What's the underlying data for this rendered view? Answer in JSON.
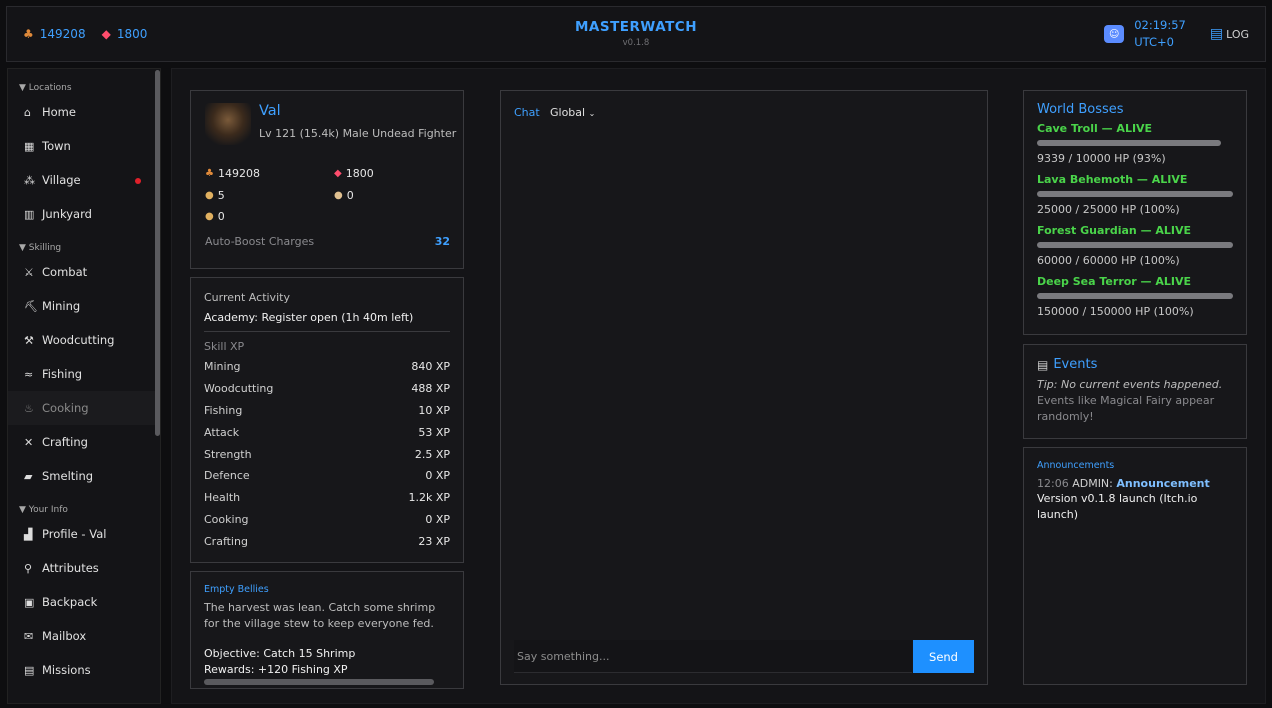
{
  "topbar": {
    "gold": "149208",
    "gems": "1800",
    "title": "MASTERWATCH",
    "version": "v0.1.8",
    "time": "02:19:57",
    "timezone": "UTC+0",
    "log_label": "LOG",
    "icons": {
      "gold": "coin-pile-icon",
      "gems": "gem-icon",
      "discord": "discord-icon",
      "log": "scroll-icon"
    }
  },
  "sidebar": {
    "sections": [
      {
        "label": "Locations",
        "items": [
          {
            "label": "Home",
            "icon": "house-icon"
          },
          {
            "label": "Town",
            "icon": "town-icon"
          },
          {
            "label": "Village",
            "icon": "village-icon",
            "notify": true
          },
          {
            "label": "Junkyard",
            "icon": "trash-icon"
          }
        ]
      },
      {
        "label": "Skilling",
        "items": [
          {
            "label": "Combat",
            "icon": "crossed-swords-icon"
          },
          {
            "label": "Mining",
            "icon": "pickaxe-icon"
          },
          {
            "label": "Woodcutting",
            "icon": "axe-icon"
          },
          {
            "label": "Fishing",
            "icon": "fish-icon"
          },
          {
            "label": "Cooking",
            "icon": "cooking-icon",
            "disabled": true
          },
          {
            "label": "Crafting",
            "icon": "hammer-icon"
          },
          {
            "label": "Smelting",
            "icon": "ingot-icon"
          }
        ]
      },
      {
        "label": "Your Info",
        "items": [
          {
            "label": "Profile - Val",
            "icon": "chart-icon"
          },
          {
            "label": "Attributes",
            "icon": "magnifier-icon"
          },
          {
            "label": "Backpack",
            "icon": "backpack-icon"
          },
          {
            "label": "Mailbox",
            "icon": "mail-icon"
          },
          {
            "label": "Missions",
            "icon": "missions-icon"
          }
        ]
      }
    ]
  },
  "character": {
    "name": "Val",
    "subtitle": "Lv 121 (15.4k)  Male Undead Fighter",
    "gold": "149208",
    "gems": "1800",
    "res_a": "5",
    "res_b": "0",
    "res_c": "0",
    "boost_label": "Auto-Boost Charges",
    "boost_value": "32"
  },
  "activity": {
    "label": "Current Activity",
    "value": "Academy: Register open (1h 40m left)",
    "xp_header": "Skill XP",
    "skills": [
      {
        "name": "Mining",
        "xp": "840 XP"
      },
      {
        "name": "Woodcutting",
        "xp": "488 XP"
      },
      {
        "name": "Fishing",
        "xp": "10 XP"
      },
      {
        "name": "Attack",
        "xp": "53 XP"
      },
      {
        "name": "Strength",
        "xp": "2.5 XP"
      },
      {
        "name": "Defence",
        "xp": "0 XP"
      },
      {
        "name": "Health",
        "xp": "1.2k XP"
      },
      {
        "name": "Cooking",
        "xp": "0 XP"
      },
      {
        "name": "Crafting",
        "xp": "23 XP"
      }
    ]
  },
  "quest": {
    "title": "Empty Bellies",
    "desc": "The harvest was lean. Catch some shrimp for the village stew to keep everyone fed.",
    "objective": "Objective: Catch 15 Shrimp",
    "rewards": "Rewards: +120 Fishing XP"
  },
  "chat": {
    "tab_label": "Chat",
    "channel": "Global",
    "placeholder": "Say something...",
    "send_label": "Send"
  },
  "bosses": {
    "title": "World Bosses",
    "list": [
      {
        "name": "Cave Troll — ALIVE",
        "hp": "9339 / 10000 HP (93%)",
        "pct": 0.93
      },
      {
        "name": "Lava Behemoth — ALIVE",
        "hp": "25000 / 25000 HP (100%)",
        "pct": 1.0
      },
      {
        "name": "Forest Guardian — ALIVE",
        "hp": "60000 / 60000 HP (100%)",
        "pct": 1.0
      },
      {
        "name": "Deep Sea Terror — ALIVE",
        "hp": "150000 / 150000 HP (100%)",
        "pct": 1.0
      }
    ]
  },
  "events": {
    "title": "Events",
    "tip": "Tip: No current events happened.",
    "desc": "Events like Magical Fairy appear randomly!"
  },
  "announcements": {
    "title": "Announcements",
    "time": "12:06",
    "author": "ADMIN:",
    "tag": "Announcement",
    "message": "Version v0.1.8 launch (Itch.io launch)"
  }
}
